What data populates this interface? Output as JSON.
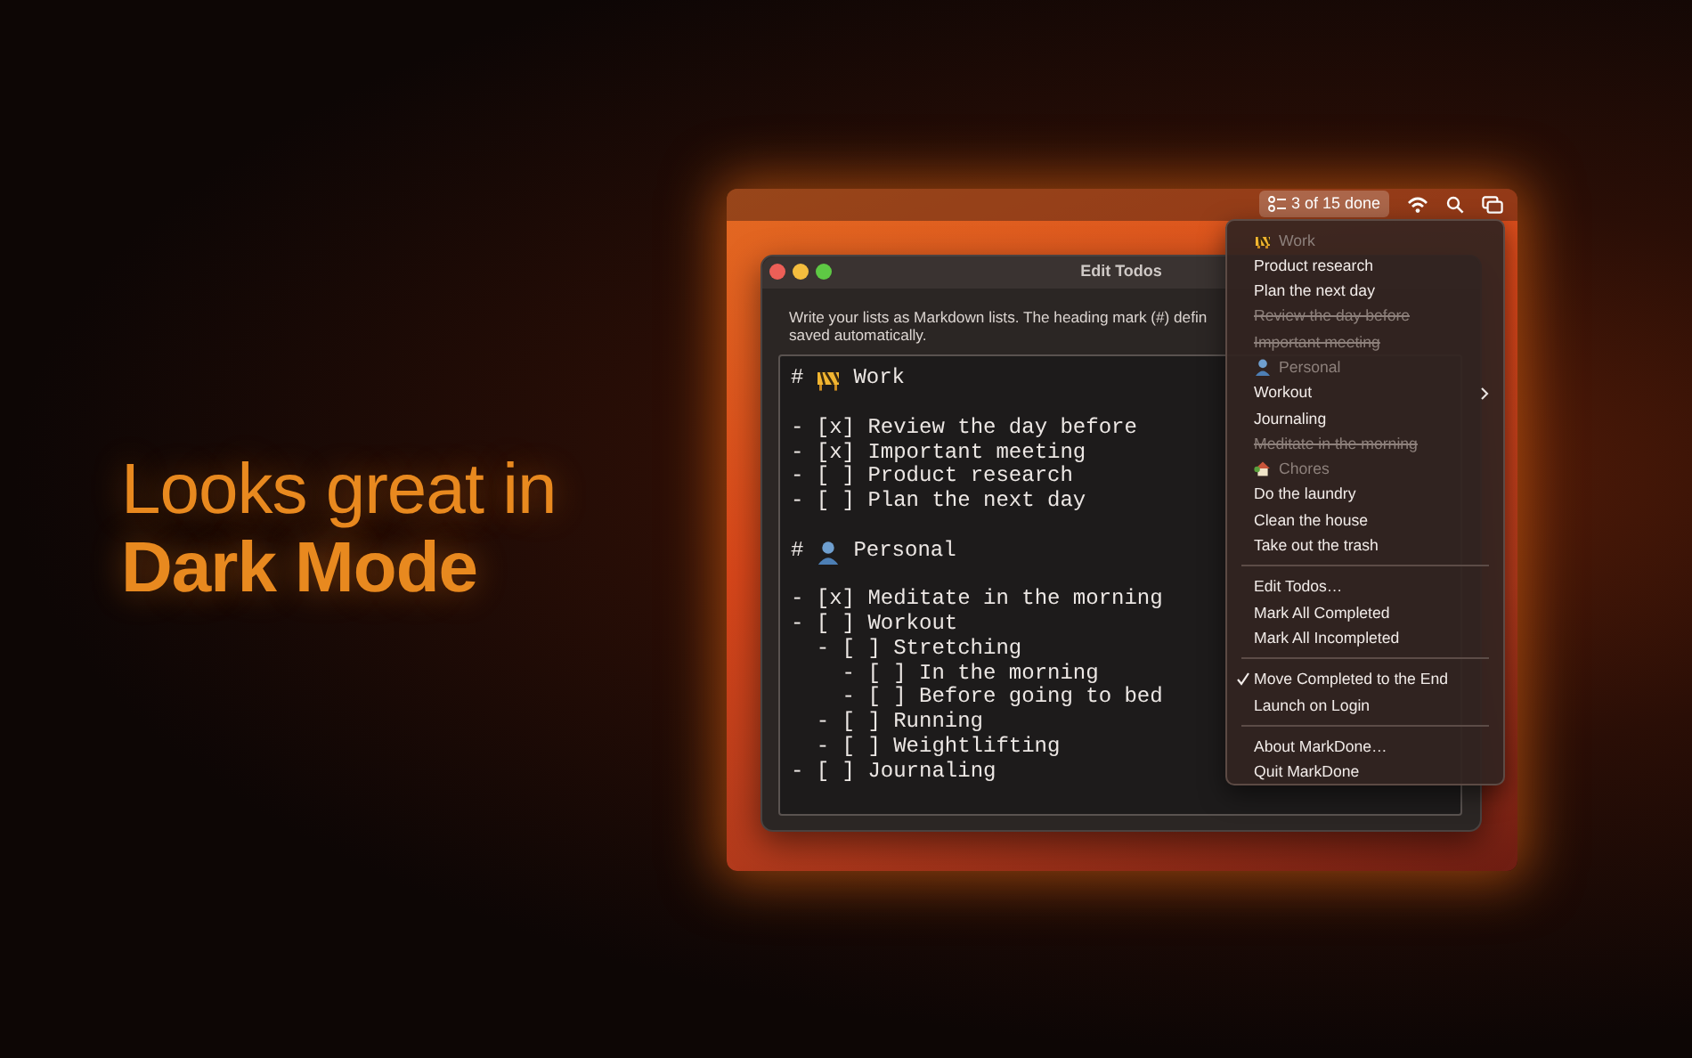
{
  "hero": {
    "line_1": "Looks great in",
    "line_2": "Dark Mode"
  },
  "menubar": {
    "status": "3 of 15 done"
  },
  "window": {
    "title": "Edit Todos",
    "description": [
      "Write your lists as Markdown lists. The heading mark (#) defin",
      "saved automatically."
    ]
  },
  "editor": {
    "sections": [
      {
        "mark": "#",
        "title": "Work",
        "items": [
          {
            "text": "- [x] Review the day before"
          },
          {
            "text": "- [x] Important meeting"
          },
          {
            "text": "- [ ] Product research"
          },
          {
            "text": "- [ ] Plan the next day"
          }
        ]
      },
      {
        "mark": "#",
        "title": "Personal",
        "items": [
          {
            "text": "- [x] Meditate in the morning"
          },
          {
            "text": "- [ ] Workout",
            "children": [
              {
                "text": "- [ ] Stretching",
                "children": [
                  {
                    "text": "- [ ] In the morning"
                  },
                  {
                    "text": "- [ ] Before going to bed"
                  }
                ]
              },
              {
                "text": "- [ ] Running"
              },
              {
                "text": "- [ ] Weightlifting"
              }
            ]
          },
          {
            "text": "- [ ] Journaling"
          }
        ]
      }
    ]
  },
  "menu": {
    "groups": [
      [
        {
          "kind": "heading",
          "label": "Work"
        },
        {
          "kind": "todo",
          "label": "Product research",
          "done": false,
          "submenu": false
        },
        {
          "kind": "todo",
          "label": "Plan the next day",
          "done": false,
          "submenu": false
        },
        {
          "kind": "todo",
          "label": "Review the day before",
          "done": true,
          "submenu": false
        },
        {
          "kind": "todo",
          "label": "Important meeting",
          "done": true,
          "submenu": false
        },
        {
          "kind": "heading",
          "label": "Personal"
        },
        {
          "kind": "todo",
          "label": "Workout",
          "done": false,
          "submenu": true
        },
        {
          "kind": "todo",
          "label": "Journaling",
          "done": false,
          "submenu": false
        },
        {
          "kind": "todo",
          "label": "Meditate in the morning",
          "done": true,
          "submenu": false
        },
        {
          "kind": "heading",
          "label": "Chores"
        },
        {
          "kind": "todo",
          "label": "Do the laundry",
          "done": false,
          "submenu": false
        },
        {
          "kind": "todo",
          "label": "Clean the house",
          "done": false,
          "submenu": false
        },
        {
          "kind": "todo",
          "label": "Take out the trash",
          "done": false,
          "submenu": false
        }
      ],
      [
        {
          "kind": "command",
          "label": "Edit Todos…"
        },
        {
          "kind": "command",
          "label": "Mark All Completed"
        },
        {
          "kind": "command",
          "label": "Mark All Incompleted"
        }
      ],
      [
        {
          "kind": "option",
          "label": "Move Completed to the End",
          "checked": true
        },
        {
          "kind": "option",
          "label": "Launch on Login",
          "checked": false
        }
      ],
      [
        {
          "kind": "command",
          "label": "About MarkDone…"
        },
        {
          "kind": "command",
          "label": "Quit MarkDone"
        }
      ]
    ]
  }
}
